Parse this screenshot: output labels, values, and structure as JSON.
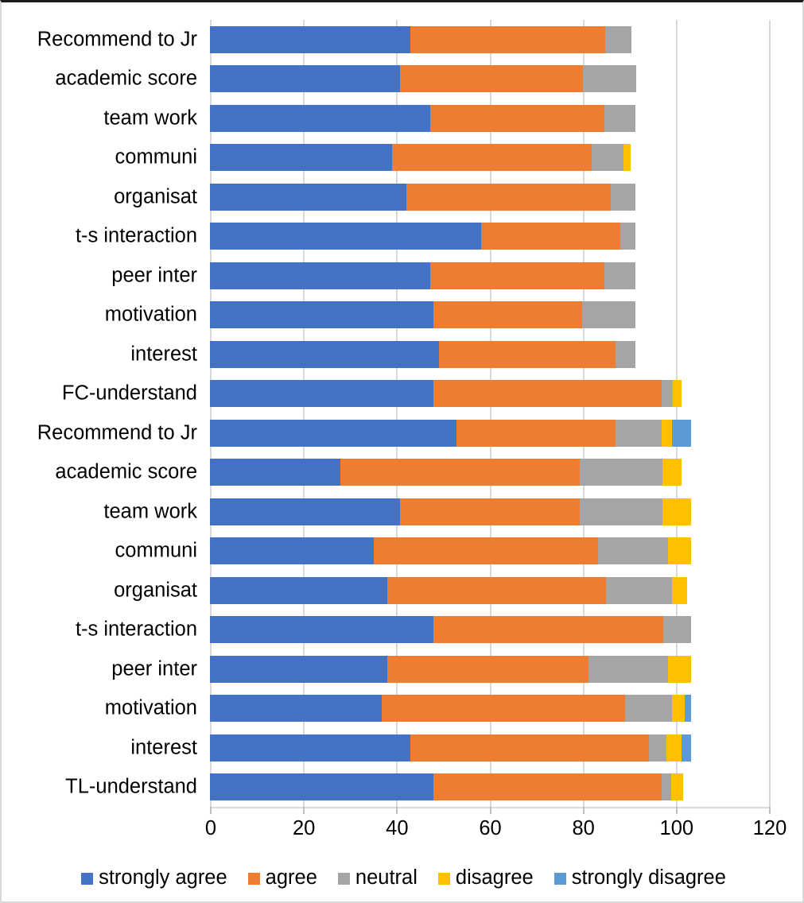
{
  "chart_data": {
    "type": "bar",
    "orientation": "horizontal",
    "stacked": true,
    "title": "",
    "xlabel": "",
    "ylabel": "",
    "xlim": [
      0,
      120
    ],
    "xticks": [
      0,
      20,
      40,
      60,
      80,
      100,
      120
    ],
    "xticklabels": [
      "0",
      "20",
      "40",
      "60",
      "80",
      "100",
      "120"
    ],
    "grid": "vertical",
    "legend_position": "bottom",
    "legend": [
      "strongly agree",
      "agree",
      "neutral",
      "disagree",
      "strongly disagree"
    ],
    "colors": {
      "strongly agree": "#4472C4",
      "agree": "#ED7D31",
      "neutral": "#A5A5A5",
      "disagree": "#FFC000",
      "strongly disagree": "#5B9BD5"
    },
    "categories": [
      "Recommend to Jr",
      "academic score",
      "team work",
      "communi",
      "organisat",
      "t-s interaction",
      "peer inter",
      "motivation",
      "interest",
      "FC-understand",
      "Recommend to Jr",
      "academic score",
      "team work",
      "communi",
      "organisat",
      "t-s interaction",
      "peer inter",
      "motivation",
      "interest",
      "TL-understand"
    ],
    "series": [
      {
        "name": "strongly agree",
        "color": "#4472C4",
        "values": [
          43.1,
          40.8,
          47.3,
          39.1,
          42.1,
          58.2,
          47.2,
          48.0,
          49.2,
          48.0,
          53.0,
          28.0,
          40.8,
          35.2,
          38.0,
          48.0,
          38.0,
          36.9,
          43.1,
          48.0
        ]
      },
      {
        "name": "agree",
        "color": "#ED7D31",
        "values": [
          41.8,
          39.2,
          37.4,
          42.9,
          43.9,
          29.8,
          37.5,
          31.9,
          37.8,
          48.9,
          34.0,
          51.3,
          38.5,
          48.1,
          47.0,
          49.3,
          43.3,
          52.2,
          51.1,
          48.9
        ]
      },
      {
        "name": "neutral",
        "color": "#A5A5A5",
        "values": [
          5.6,
          11.5,
          6.7,
          6.8,
          5.3,
          3.3,
          6.6,
          11.4,
          4.3,
          2.5,
          9.9,
          17.9,
          17.9,
          15.1,
          14.2,
          5.9,
          17.1,
          10.1,
          3.8,
          2.1
        ]
      },
      {
        "name": "disagree",
        "color": "#FFC000",
        "values": [
          0.0,
          0.0,
          0.0,
          1.5,
          0.0,
          0.0,
          0.0,
          0.0,
          0.0,
          1.9,
          2.3,
          4.1,
          6.0,
          4.8,
          3.3,
          0.0,
          4.8,
          2.7,
          3.3,
          2.5
        ]
      },
      {
        "name": "strongly disagree",
        "color": "#5B9BD5",
        "values": [
          0.0,
          0.0,
          0.0,
          0.0,
          0.0,
          0.0,
          0.0,
          0.0,
          0.0,
          0.0,
          4.0,
          0.0,
          0.0,
          0.0,
          0.0,
          0.0,
          0.0,
          1.3,
          1.9,
          0.0
        ]
      }
    ]
  }
}
